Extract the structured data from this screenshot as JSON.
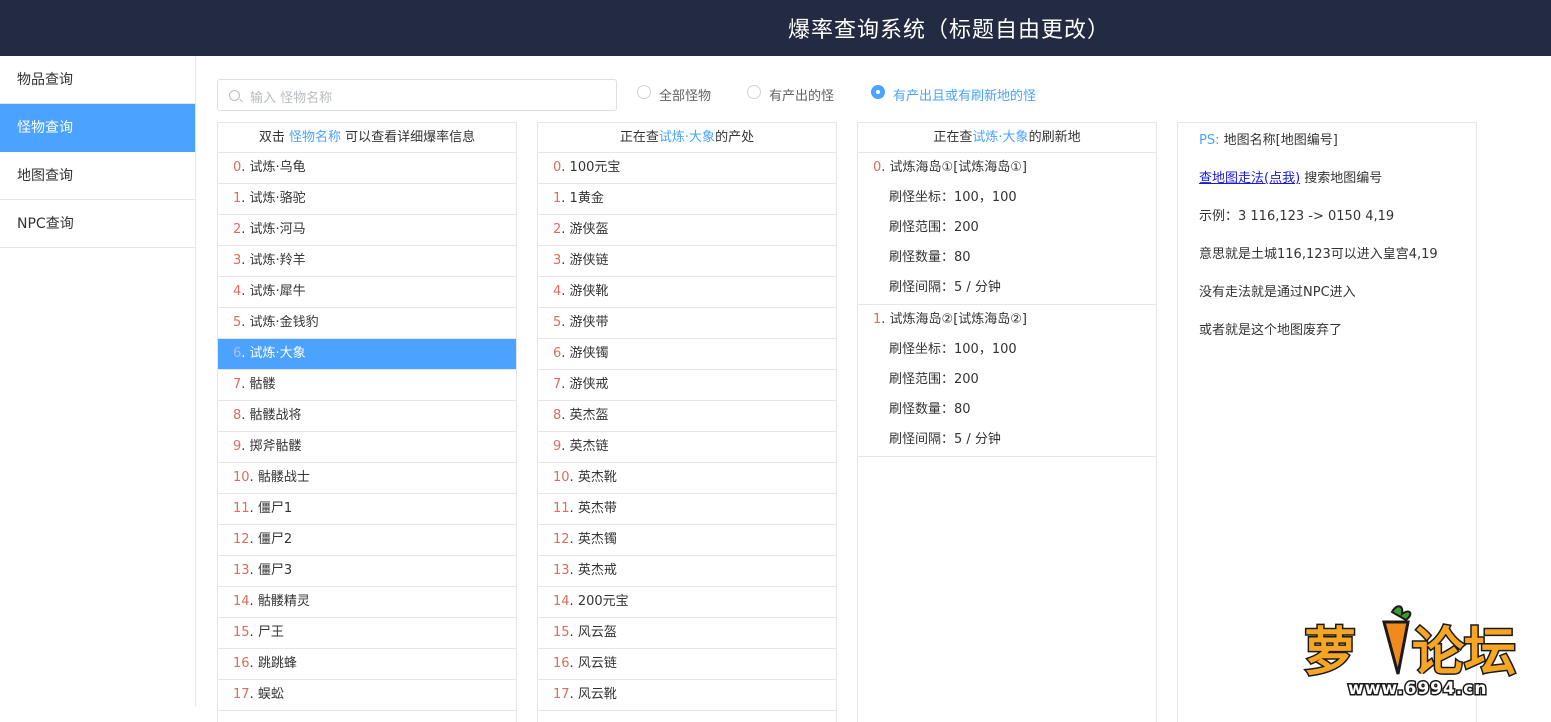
{
  "header": {
    "title": "爆率查询系统（标题自由更改）"
  },
  "sidebar": {
    "items": [
      {
        "label": "物品查询"
      },
      {
        "label": "怪物查询"
      },
      {
        "label": "地图查询"
      },
      {
        "label": "NPC查询"
      }
    ]
  },
  "search": {
    "placeholder": "输入 怪物名称"
  },
  "filters": {
    "options": [
      {
        "label": "全部怪物"
      },
      {
        "label": "有产出的怪"
      },
      {
        "label": "有产出且或有刷新地的怪"
      }
    ]
  },
  "monsters": {
    "header_prefix": "双击 ",
    "header_link": "怪物名称",
    "header_suffix": " 可以查看详细爆率信息",
    "items": [
      {
        "num": "0",
        "name": "试炼·乌龟"
      },
      {
        "num": "1",
        "name": "试炼·骆驼"
      },
      {
        "num": "2",
        "name": "试炼·河马"
      },
      {
        "num": "3",
        "name": "试炼·羚羊"
      },
      {
        "num": "4",
        "name": "试炼·犀牛"
      },
      {
        "num": "5",
        "name": "试炼·金钱豹"
      },
      {
        "num": "6",
        "name": "试炼·大象"
      },
      {
        "num": "7",
        "name": "骷髅"
      },
      {
        "num": "8",
        "name": "骷髅战将"
      },
      {
        "num": "9",
        "name": "掷斧骷髅"
      },
      {
        "num": "10",
        "name": "骷髅战士"
      },
      {
        "num": "11",
        "name": "僵尸1"
      },
      {
        "num": "12",
        "name": "僵尸2"
      },
      {
        "num": "13",
        "name": "僵尸3"
      },
      {
        "num": "14",
        "name": "骷髅精灵"
      },
      {
        "num": "15",
        "name": "尸王"
      },
      {
        "num": "16",
        "name": "跳跳蜂"
      },
      {
        "num": "17",
        "name": "蜈蚣"
      }
    ]
  },
  "drops": {
    "header_prefix": "正在查",
    "header_monster": "试炼·大象",
    "header_suffix": "的产处",
    "items": [
      {
        "num": "0",
        "name": "100元宝"
      },
      {
        "num": "1",
        "name": "1黄金"
      },
      {
        "num": "2",
        "name": "游侠盔"
      },
      {
        "num": "3",
        "name": "游侠链"
      },
      {
        "num": "4",
        "name": "游侠靴"
      },
      {
        "num": "5",
        "name": "游侠带"
      },
      {
        "num": "6",
        "name": "游侠镯"
      },
      {
        "num": "7",
        "name": "游侠戒"
      },
      {
        "num": "8",
        "name": "英杰盔"
      },
      {
        "num": "9",
        "name": "英杰链"
      },
      {
        "num": "10",
        "name": "英杰靴"
      },
      {
        "num": "11",
        "name": "英杰带"
      },
      {
        "num": "12",
        "name": "英杰镯"
      },
      {
        "num": "13",
        "name": "英杰戒"
      },
      {
        "num": "14",
        "name": "200元宝"
      },
      {
        "num": "15",
        "name": "风云盔"
      },
      {
        "num": "16",
        "name": "风云链"
      },
      {
        "num": "17",
        "name": "风云靴"
      }
    ]
  },
  "spawns": {
    "header_prefix": "正在查",
    "header_monster": "试炼·大象",
    "header_suffix": "的刷新地",
    "items": [
      {
        "num": "0",
        "name": "试炼海岛①[试炼海岛①]",
        "coords": "刷怪坐标：100，100",
        "range": "刷怪范围：200",
        "count": "刷怪数量：80",
        "interval": "刷怪间隔：5 / 分钟"
      },
      {
        "num": "1",
        "name": "试炼海岛②[试炼海岛②]",
        "coords": "刷怪坐标：100，100",
        "range": "刷怪范围：200",
        "count": "刷怪数量：80",
        "interval": "刷怪间隔：5 / 分钟"
      }
    ]
  },
  "info": {
    "ps_label": "PS:",
    "ps_text": "地图名称[地图编号]",
    "link": "查地图走法(点我)",
    "link_suffix": " 搜索地图编号",
    "example": "示例：3 116,123 -> 0150 4,19",
    "meaning": "意思就是土城116,123可以进入皇宫4,19",
    "npc": "没有走法就是通过NPC进入",
    "abandoned": "或者就是这个地图废弃了"
  },
  "watermark": {
    "text": "萝卜论坛",
    "url": "www.6994.cn"
  },
  "colors": {
    "header_bg": "#232b42",
    "accent": "#4ba3ff",
    "index": "#e06c5a"
  }
}
